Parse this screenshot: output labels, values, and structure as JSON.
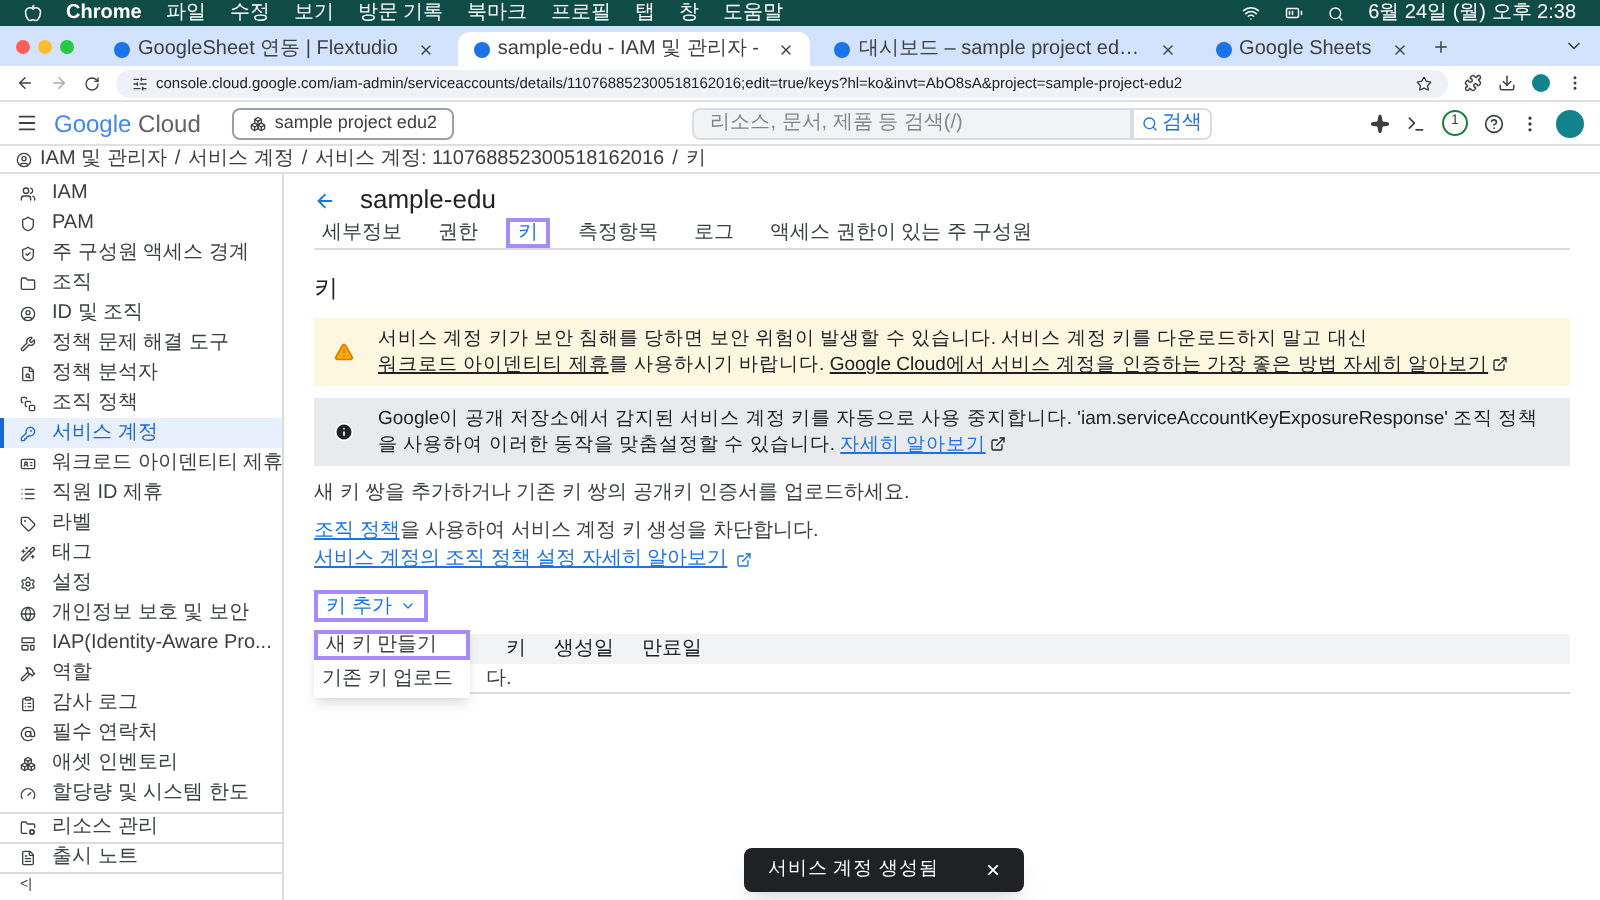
{
  "menu_bar": {
    "app": "Chrome",
    "items": [
      "파일",
      "수정",
      "보기",
      "방문 기록",
      "북마크",
      "프로필",
      "탭",
      "창",
      "도움말"
    ],
    "clock": "6월 24일 (월) 오후 2:38"
  },
  "browser_tabs": [
    {
      "title": "GoogleSheet 연동 | Flextudio",
      "selected": false
    },
    {
      "title": "sample-edu - IAM 및 관리자 -",
      "selected": true
    },
    {
      "title": "대시보드 – sample project ed…",
      "selected": false
    },
    {
      "title": "Google Sheets",
      "selected": false
    }
  ],
  "address": "console.cloud.google.com/iam-admin/serviceaccounts/details/110768852300518162016;edit=true/keys?hl=ko&invt=AbO8sA&project=sample-project-edu2",
  "header": {
    "logo_word1": "Google",
    "logo_word2": "Cloud",
    "project": "sample project edu2",
    "search_placeholder": "리소스, 문서, 제품 등 검색(/)",
    "search_button": "검색",
    "notifications": "1"
  },
  "breadcrumb": {
    "separator": "/",
    "items": [
      "IAM 및 관리자",
      "서비스 계정",
      "서비스 계정: 110768852300518162016",
      "키"
    ]
  },
  "sidebar": {
    "items": [
      {
        "label": "IAM",
        "selected": false
      },
      {
        "label": "PAM",
        "selected": false
      },
      {
        "label": "주 구성원 액세스 경계",
        "selected": false
      },
      {
        "label": "조직",
        "selected": false
      },
      {
        "label": "ID 및 조직",
        "selected": false
      },
      {
        "label": "정책 문제 해결 도구",
        "selected": false
      },
      {
        "label": "정책 분석자",
        "selected": false
      },
      {
        "label": "조직 정책",
        "selected": false
      },
      {
        "label": "서비스 계정",
        "selected": true
      },
      {
        "label": "워크로드 아이덴티티 제휴",
        "selected": false
      },
      {
        "label": "직원 ID 제휴",
        "selected": false
      },
      {
        "label": "라벨",
        "selected": false
      },
      {
        "label": "태그",
        "selected": false
      },
      {
        "label": "설정",
        "selected": false
      },
      {
        "label": "개인정보 보호 및 보안",
        "selected": false
      },
      {
        "label": "IAP(Identity-Aware Pro...",
        "selected": false
      },
      {
        "label": "역할",
        "selected": false
      },
      {
        "label": "감사 로그",
        "selected": false
      },
      {
        "label": "필수 연락처",
        "selected": false
      },
      {
        "label": "애셋 인벤토리",
        "selected": false
      },
      {
        "label": "할당량 및 시스템 한도",
        "selected": false
      }
    ],
    "footer_items": [
      "리소스 관리",
      "출시 노트"
    ],
    "collapse": "<|"
  },
  "page": {
    "title": "sample-edu",
    "tabs": [
      {
        "label": "세부정보",
        "selected": false
      },
      {
        "label": "권한",
        "selected": false
      },
      {
        "label": "키",
        "selected": true
      },
      {
        "label": "측정항목",
        "selected": false
      },
      {
        "label": "로그",
        "selected": false
      },
      {
        "label": "액세스 권한이 있는 주 구성원",
        "selected": false
      }
    ],
    "heading": "키",
    "banners": [
      {
        "kind": "warning",
        "parts": [
          {
            "kind": "text",
            "text": "서비스 계정 키가 보안 침해를 당하면 보안 위험이 발생할 수 있습니다. 서비스 계정 키를 다운로드하지 말고 대신 "
          },
          {
            "kind": "link",
            "text": "워크로드 아이덴티티 제휴"
          },
          {
            "kind": "text",
            "text": "를 사용하시기 바랍니다. "
          },
          {
            "kind": "link",
            "text": "Google Cloud에서 서비스 계정을 인증하는 가장 좋은 방법 자세히 알아보기"
          }
        ]
      },
      {
        "kind": "info",
        "parts": [
          {
            "kind": "text",
            "text": "Google이 공개 저장소에서 감지된 서비스 계정 키를 자동으로 사용 중지합니다. 'iam.serviceAccountKeyExposureResponse' 조직 정책을 사용하여 이러한 동작을 맞춤설정할 수 있습니다. "
          },
          {
            "kind": "link",
            "text": "자세히 알아보기"
          }
        ]
      }
    ],
    "intro": "새 키 쌍을 추가하거나 기존 키 쌍의 공개키 인증서를 업로드하세요.",
    "policy_link": "조직 정책",
    "policy_text": "을 사용하여 서비스 계정 키 생성을 차단합니다.",
    "policy_more_link": "서비스 계정의 조직 정책 설정 자세히 알아보기",
    "add_key_button": "키 추가",
    "add_key_menu": [
      {
        "label": "새 키 만들기",
        "selected": true
      },
      {
        "label": "기존 키 업로드",
        "selected": false
      }
    ],
    "table": {
      "columns": [
        "키",
        "생성일",
        "만료일"
      ],
      "empty_text": "다."
    }
  },
  "toast": {
    "message": "서비스 계정 생성됨",
    "close": "×"
  }
}
